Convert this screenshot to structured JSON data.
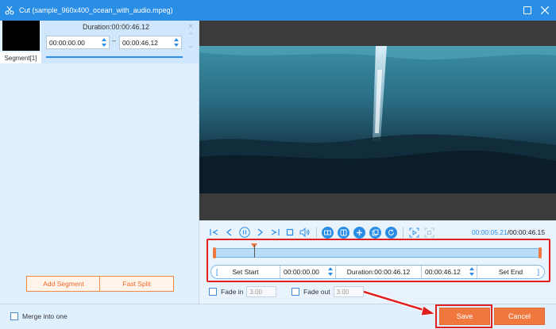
{
  "window": {
    "title": "Cut (sample_960x400_ocean_with_audio.mpeg)"
  },
  "segment_panel": {
    "segment_label": "Segment[1]",
    "duration_text": "Duration:00:00:46.12",
    "start_time": "00:00:00.00",
    "end_time": "00:00:46.12",
    "separator": "–"
  },
  "left_buttons": {
    "add_segment": "Add Segment",
    "fast_split": "Fast Split"
  },
  "playback": {
    "current_time": "00:00:05.21",
    "total_time": "/00:00:46.15"
  },
  "trim": {
    "set_start": "Set Start",
    "start_time": "00:00:00.00",
    "duration": "Duration:00:00:46.12",
    "end_time": "00:00:46.12",
    "set_end": "Set End",
    "timeline_position": 0.12
  },
  "fade": {
    "fade_in_label": "Fade in",
    "fade_in_value": "3.00",
    "fade_out_label": "Fade out",
    "fade_out_value": "3.00"
  },
  "bottom": {
    "merge_label": "Merge into one",
    "save": "Save",
    "cancel": "Cancel"
  },
  "colors": {
    "accent": "#2b8ee6",
    "orange": "#f0783e",
    "highlight": "#e02020"
  }
}
